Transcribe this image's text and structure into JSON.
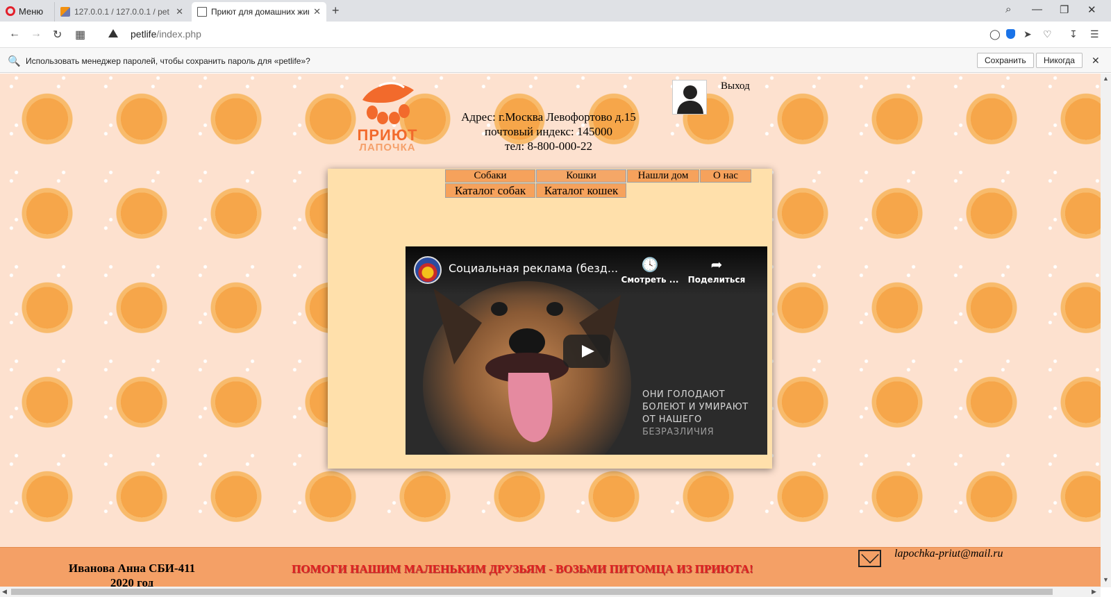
{
  "browser": {
    "menu_label": "Меню",
    "tabs": [
      {
        "label": "127.0.0.1 / 127.0.0.1 / pet /",
        "active": false
      },
      {
        "label": "Приют для домашних жив",
        "active": true
      }
    ],
    "url_host": "petlife",
    "url_path": "/index.php"
  },
  "password_bar": {
    "text": "Использовать менеджер паролей, чтобы сохранить пароль для «petlife»?",
    "save_label": "Сохранить",
    "never_label": "Никогда"
  },
  "header": {
    "logo_title": "ПРИЮТ",
    "logo_subtitle": "ЛАПОЧКА",
    "address_line1": "Адрес: г.Москва Левофортово д.15",
    "address_line2": "почтовый индекс: 145000",
    "address_line3": "тел: 8-800-000-22",
    "logout_label": "Выход"
  },
  "menu": {
    "dogs": "Собаки",
    "cats": "Кошки",
    "found_home": "Нашли дом",
    "about": "О нас",
    "dog_catalog": "Каталог собак",
    "cat_catalog": "Каталог кошек"
  },
  "video": {
    "title": "Социальная реклама (безд...",
    "watch_later": "Смотреть ...",
    "share": "Поделиться",
    "caption": [
      "ОНИ ГОЛОДАЮТ",
      "БОЛЕЮТ И УМИРАЮТ",
      "ОТ НАШЕГО",
      "БЕЗРАЗЛИЧИЯ"
    ]
  },
  "footer": {
    "author_name": "Иванова Анна СБИ-411",
    "year": "2020 год",
    "slogan": "ПОМОГИ НАШИМ МАЛЕНЬКИМ ДРУЗЬЯМ - ВОЗЬМИ ПИТОМЦА ИЗ ПРИЮТА!",
    "email": "lapochka-priut@mail.ru"
  },
  "colors": {
    "accent_orange": "#f4a066",
    "panel_bg": "#ffe0ab",
    "slogan_red": "#e02020"
  }
}
